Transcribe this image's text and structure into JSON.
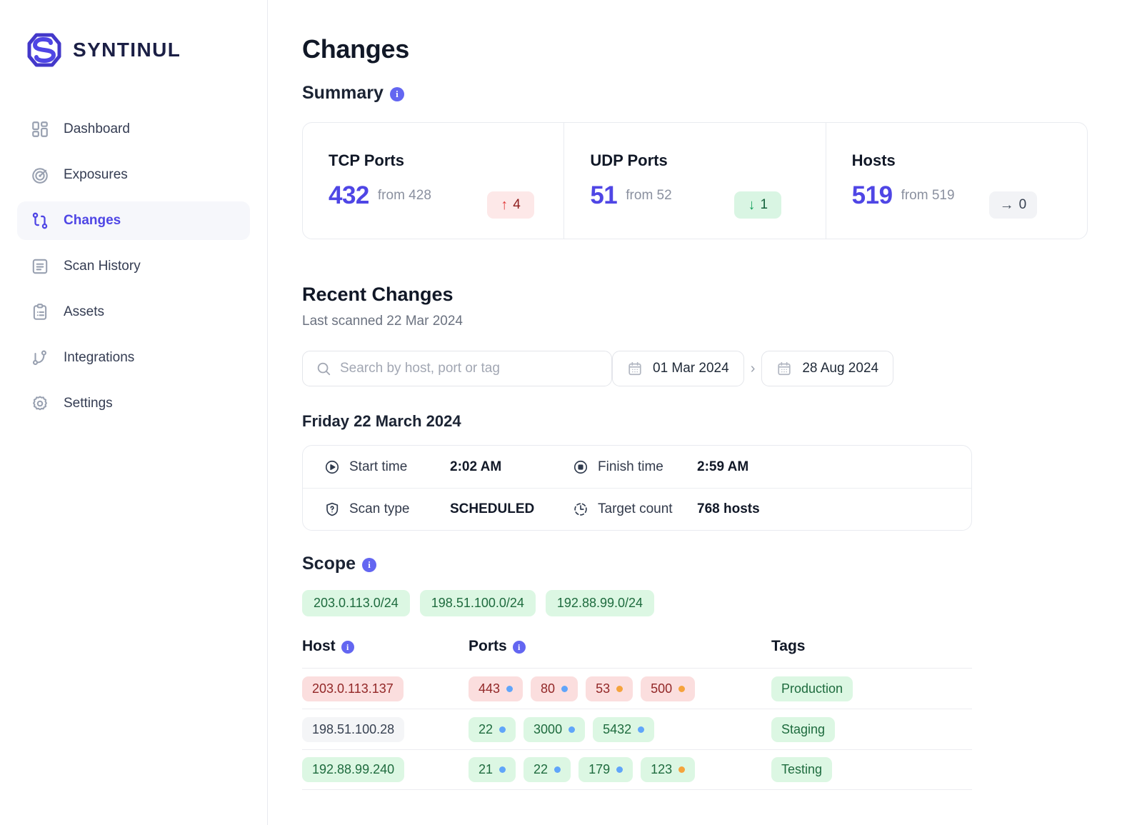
{
  "brand": {
    "name": "SYNTINUL"
  },
  "sidebar": {
    "items": [
      {
        "label": "Dashboard",
        "icon": "dashboard-grid-icon",
        "active": false
      },
      {
        "label": "Exposures",
        "icon": "radar-icon",
        "active": false
      },
      {
        "label": "Changes",
        "icon": "git-branch-icon",
        "active": true
      },
      {
        "label": "Scan History",
        "icon": "document-lines-icon",
        "active": false
      },
      {
        "label": "Assets",
        "icon": "clipboard-list-icon",
        "active": false
      },
      {
        "label": "Integrations",
        "icon": "node-link-icon",
        "active": false
      },
      {
        "label": "Settings",
        "icon": "gear-icon",
        "active": false
      }
    ]
  },
  "page": {
    "title": "Changes"
  },
  "summary": {
    "heading": "Summary",
    "info": "i",
    "cards": [
      {
        "title": "TCP Ports",
        "value": "432",
        "from": "from 428",
        "delta_arrow": "↑",
        "delta_value": "4",
        "delta_dir": "up"
      },
      {
        "title": "UDP Ports",
        "value": "51",
        "from": "from 52",
        "delta_arrow": "↓",
        "delta_value": "1",
        "delta_dir": "down"
      },
      {
        "title": "Hosts",
        "value": "519",
        "from": "from 519",
        "delta_arrow": "→",
        "delta_value": "0",
        "delta_dir": "flat"
      }
    ]
  },
  "recent": {
    "title": "Recent Changes",
    "subtitle": "Last scanned 22 Mar 2024",
    "search_placeholder": "Search by host, port or tag",
    "date_from": "01 Mar 2024",
    "date_sep": "›",
    "date_to": "28 Aug 2024"
  },
  "day": {
    "title": "Friday 22 March 2024",
    "start_label": "Start time",
    "start_value": "2:02 AM",
    "finish_label": "Finish time",
    "finish_value": "2:59 AM",
    "type_label": "Scan type",
    "type_value": "SCHEDULED",
    "target_label": "Target count",
    "target_value": "768 hosts"
  },
  "scope": {
    "heading": "Scope",
    "info": "i",
    "ranges": [
      "203.0.113.0/24",
      "198.51.100.0/24",
      "192.88.99.0/24"
    ]
  },
  "table": {
    "columns": {
      "host": "Host",
      "ports": "Ports",
      "tags": "Tags"
    },
    "rows": [
      {
        "host": "203.0.113.137",
        "host_style": "red",
        "ports": [
          {
            "port": "443",
            "proto": "tcp",
            "style": "red"
          },
          {
            "port": "80",
            "proto": "tcp",
            "style": "red"
          },
          {
            "port": "53",
            "proto": "udp",
            "style": "red"
          },
          {
            "port": "500",
            "proto": "udp",
            "style": "red"
          }
        ],
        "tag": "Production",
        "tag_style": "green"
      },
      {
        "host": "198.51.100.28",
        "host_style": "gray",
        "ports": [
          {
            "port": "22",
            "proto": "tcp",
            "style": "green"
          },
          {
            "port": "3000",
            "proto": "tcp",
            "style": "green"
          },
          {
            "port": "5432",
            "proto": "tcp",
            "style": "green"
          }
        ],
        "tag": "Staging",
        "tag_style": "green"
      },
      {
        "host": "192.88.99.240",
        "host_style": "green",
        "ports": [
          {
            "port": "21",
            "proto": "tcp",
            "style": "green"
          },
          {
            "port": "22",
            "proto": "tcp",
            "style": "green"
          },
          {
            "port": "179",
            "proto": "tcp",
            "style": "green"
          },
          {
            "port": "123",
            "proto": "udp",
            "style": "green"
          }
        ],
        "tag": "Testing",
        "tag_style": "green"
      }
    ]
  },
  "colors": {
    "accent": "#4f46e5",
    "info_badge": "#6366f1",
    "up": "#e23b3b",
    "down": "#17a35f",
    "flat": "#4b5563",
    "tcp_dot": "#60a5fa",
    "udp_dot": "#f5a33c",
    "green_pill_bg": "#dcf7e3",
    "red_pill_bg": "#fbdede"
  }
}
